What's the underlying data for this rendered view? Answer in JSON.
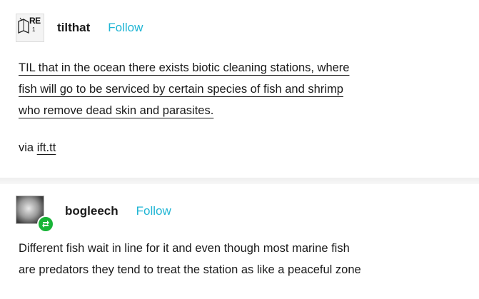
{
  "posts": [
    {
      "avatar": {
        "icon": "tilthat-avatar",
        "text_line1": "RE",
        "text_line2": "1"
      },
      "username": "tilthat",
      "follow_label": "Follow",
      "body_lines": [
        "TIL that in the ocean there exists biotic cleaning stations, where",
        "fish will go to be serviced by certain species of fish and shrimp",
        "who remove dead skin and parasites."
      ],
      "via_prefix": "via",
      "via_link": "ift.tt"
    },
    {
      "avatar": {
        "icon": "bogleech-avatar",
        "badge_icon": "reblog-icon",
        "badge_color": "#18b437"
      },
      "username": "bogleech",
      "follow_label": "Follow",
      "body_lines": [
        "Different fish wait in line for it and even though most marine fish",
        "are predators they tend to treat the station as like a peaceful zone"
      ]
    }
  ],
  "colors": {
    "follow": "#1fb5d4",
    "text": "#1a1a1a"
  }
}
